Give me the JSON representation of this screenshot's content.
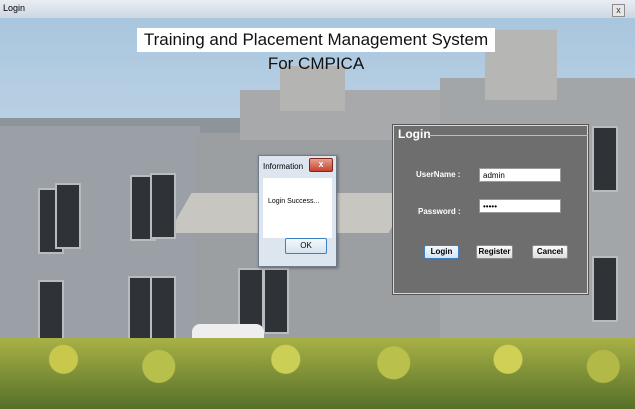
{
  "window": {
    "title": "Login",
    "close_glyph": "x"
  },
  "banner": {
    "text": "Training and Placement Management System For CMPICA"
  },
  "info_dialog": {
    "title": "Information",
    "close_glyph": "x",
    "message": "Login Success...",
    "ok_label": "OK"
  },
  "login_form": {
    "title": "Login",
    "username_label": "UserName :",
    "username_value": "admin",
    "password_label": "Password :",
    "password_value": "•••••",
    "login_label": "Login",
    "register_label": "Register",
    "cancel_label": "Cancel"
  }
}
